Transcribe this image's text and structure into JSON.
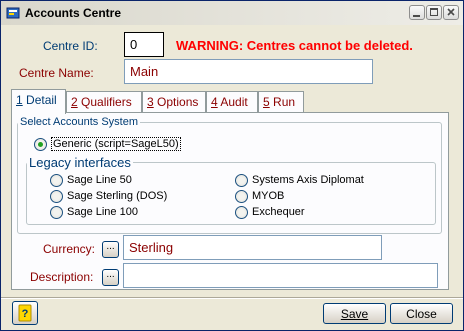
{
  "window": {
    "title": "Accounts Centre",
    "title_buttons": [
      "minimize-icon",
      "maximize-icon",
      "close-icon"
    ]
  },
  "header": {
    "centre_id_label": "Centre ID:",
    "centre_id_value": "0",
    "warning": "WARNING: Centres cannot be deleted.",
    "centre_name_label": "Centre Name:",
    "centre_name_value": "Main"
  },
  "tabs": [
    {
      "key": "1",
      "label": " Detail",
      "active": true
    },
    {
      "key": "2",
      "label": " Qualifiers",
      "active": false
    },
    {
      "key": "3",
      "label": " Options",
      "active": false
    },
    {
      "key": "4",
      "label": " Audit",
      "active": false
    },
    {
      "key": "5",
      "label": " Run",
      "active": false
    }
  ],
  "detail": {
    "system_group_title": "Select Accounts System",
    "generic_option": "Generic (script=SageL50)",
    "legacy_group_title": "Legacy interfaces",
    "legacy_left": [
      "Sage Line 50",
      "Sage Sterling (DOS)",
      "Sage Line 100"
    ],
    "legacy_right": [
      "Systems Axis Diplomat",
      "MYOB",
      "Exchequer"
    ],
    "selected": "Generic (script=SageL50)",
    "currency_label": "Currency:",
    "currency_value": "Sterling",
    "description_label": "Description:",
    "description_value": "",
    "ellipsis": "..."
  },
  "footer": {
    "save_label": "Save",
    "close_label": "Close"
  },
  "colors": {
    "label_blue": "#003c74",
    "label_darkred": "#8b0000",
    "warning_red": "#ff0000",
    "radio_selected": "#21a121"
  }
}
